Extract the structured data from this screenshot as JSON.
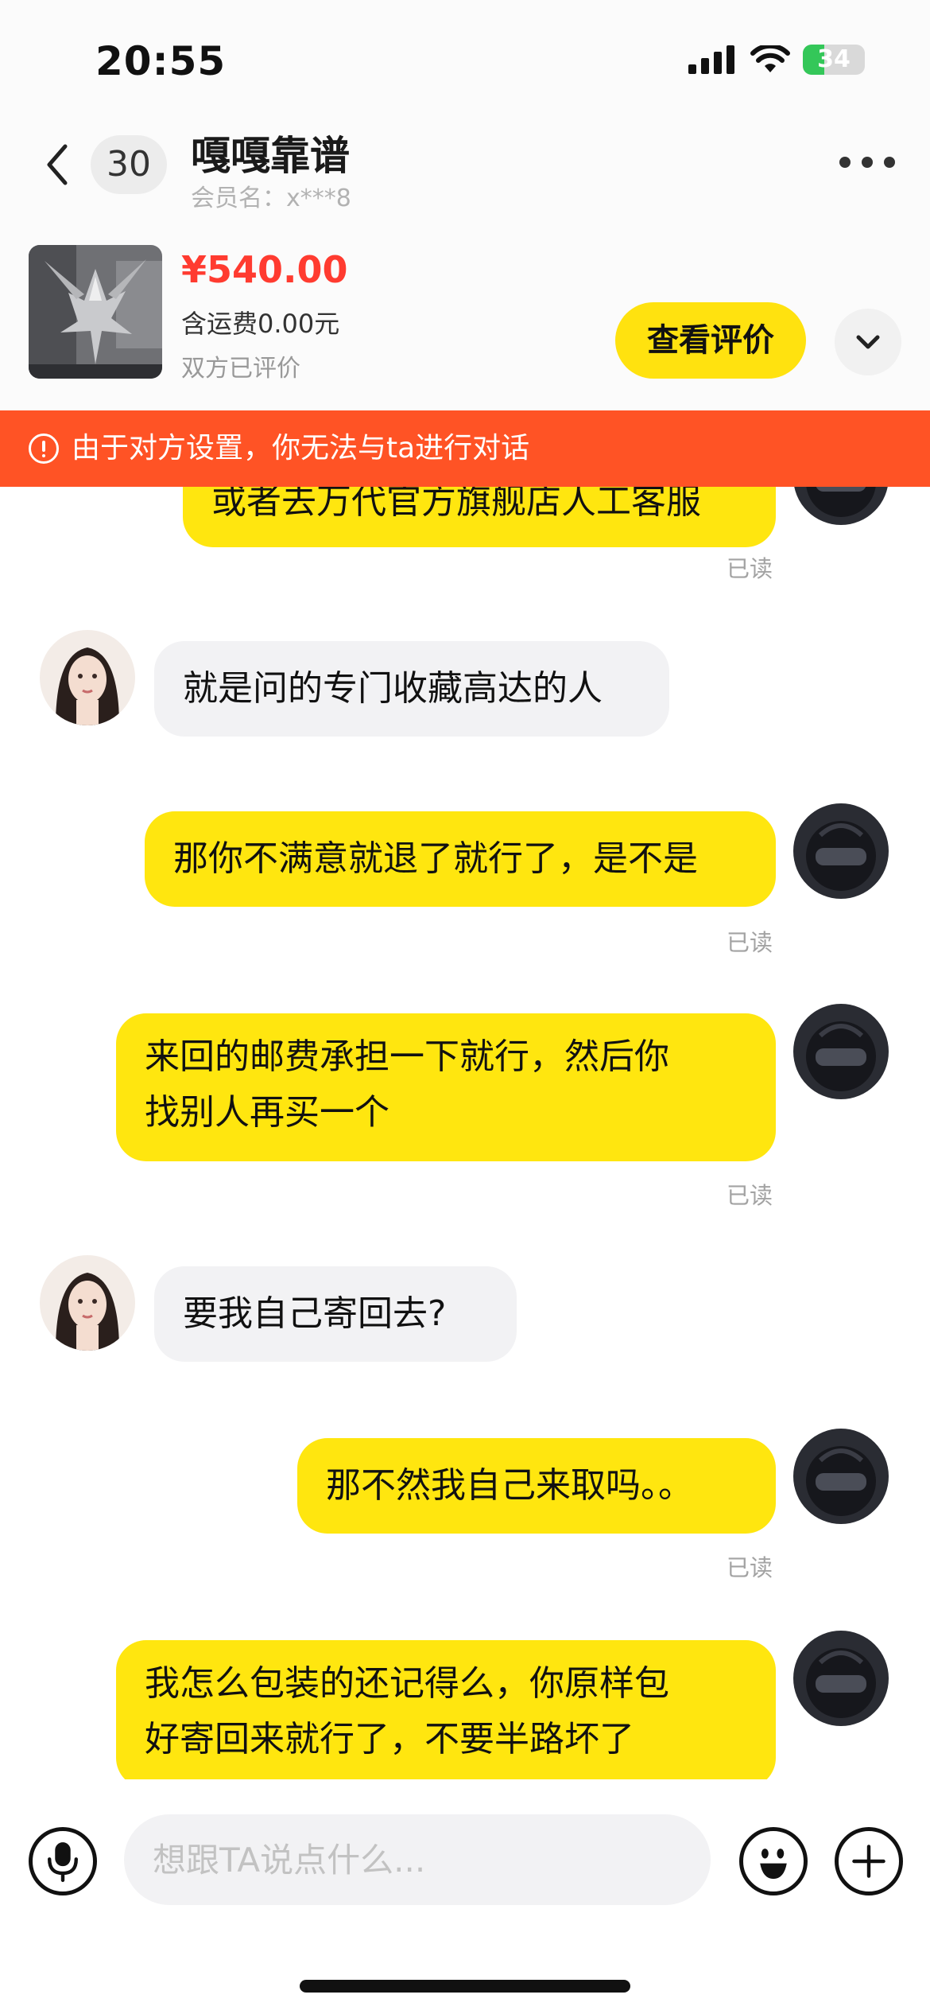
{
  "status_bar": {
    "time": "20:55",
    "battery": "34",
    "battery_level": 0.34,
    "icons": [
      "signal-icon",
      "wifi-icon",
      "battery-icon"
    ]
  },
  "header": {
    "unread_count": "30",
    "contact_name": "嘎嘎靠谱",
    "member_label": "会员名：x***8",
    "icons": [
      "back-icon",
      "more-icon"
    ]
  },
  "product": {
    "price": "¥540.00",
    "shipping": "含运费0.00元",
    "review_status": "双方已评价",
    "review_button": "查看评价",
    "icons": [
      "chevron-down-icon"
    ]
  },
  "warning": {
    "text": "由于对方设置，你无法与ta进行对话",
    "icon": "alert-icon"
  },
  "messages": [
    {
      "side": "mine",
      "text": "或者去万代官方旗舰店人工客服",
      "read": "已读"
    },
    {
      "side": "theirs",
      "text": "就是问的专门收藏高达的人"
    },
    {
      "side": "mine",
      "text": "那你不满意就退了就行了，是不是",
      "read": "已读"
    },
    {
      "side": "mine",
      "lines": [
        "来回的邮费承担一下就行，然后你",
        "找别人再买一个"
      ],
      "read": "已读"
    },
    {
      "side": "theirs",
      "text": "要我自己寄回去?"
    },
    {
      "side": "mine",
      "text": "那不然我自己来取吗。。",
      "read": "已读"
    },
    {
      "side": "mine",
      "lines": [
        "我怎么包装的还记得么，你原样包",
        "好寄回来就行了，不要半路坏了"
      ]
    }
  ],
  "input_bar": {
    "placeholder": "想跟TA说点什么...",
    "icons": [
      "microphone-icon",
      "emoji-icon",
      "plus-icon"
    ]
  },
  "colors": {
    "accent_yellow": "#ffe20f",
    "price_red": "#ff3b30",
    "warning_orange": "#ff5325",
    "bubble_gray": "#f2f2f4"
  }
}
